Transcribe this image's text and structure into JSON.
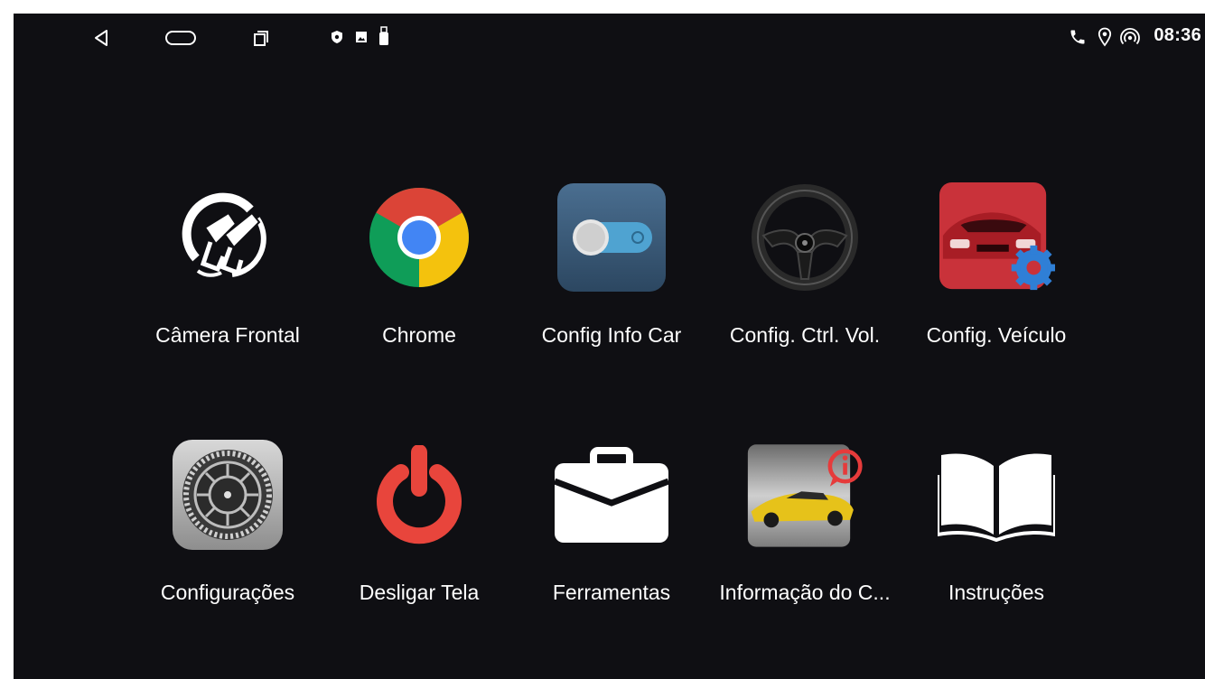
{
  "status_bar": {
    "nav_back_icon": "back-triangle-icon",
    "nav_home_icon": "home-pill-icon",
    "nav_recents_icon": "recents-icon",
    "notification_icons": [
      "shield-icon",
      "image-icon",
      "usb-icon"
    ],
    "right_icons": [
      "phone-icon",
      "location-icon",
      "hotspot-icon"
    ],
    "time": "08:36"
  },
  "apps": [
    {
      "label": "Câmera Frontal",
      "icon": "camera-cables-icon"
    },
    {
      "label": "Chrome",
      "icon": "chrome-icon"
    },
    {
      "label": "Config Info Car",
      "icon": "toggle-switch-icon"
    },
    {
      "label": "Config. Ctrl. Vol.",
      "icon": "steering-wheel-icon"
    },
    {
      "label": "Config. Veículo",
      "icon": "car-gear-icon"
    },
    {
      "label": "Configurações",
      "icon": "settings-gear-icon"
    },
    {
      "label": "Desligar Tela",
      "icon": "power-icon"
    },
    {
      "label": "Ferramentas",
      "icon": "briefcase-icon"
    },
    {
      "label": "Informação do C...",
      "icon": "car-info-icon"
    },
    {
      "label": "Instruções",
      "icon": "open-book-icon"
    }
  ],
  "colors": {
    "background": "#0f0f13",
    "chrome_red": "#db4437",
    "chrome_yellow": "#f4c20d",
    "chrome_green": "#0f9d58",
    "chrome_blue": "#4285f4",
    "power_red": "#e8453c",
    "toggle_bg": "#3b5a78"
  }
}
